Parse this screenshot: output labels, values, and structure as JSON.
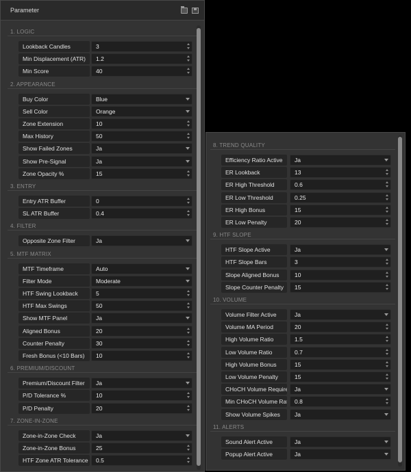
{
  "left": {
    "title": "Parameter",
    "sections": [
      {
        "label": "1. LOGIC",
        "rows": [
          {
            "label": "Lookback Candles",
            "value": "3",
            "kind": "spin"
          },
          {
            "label": "Min Displacement (ATR)",
            "value": "1.2",
            "kind": "spin"
          },
          {
            "label": "Min Score",
            "value": "40",
            "kind": "spin"
          }
        ]
      },
      {
        "label": "2. APPEARANCE",
        "rows": [
          {
            "label": "Buy Color",
            "value": "Blue",
            "kind": "select"
          },
          {
            "label": "Sell Color",
            "value": "Orange",
            "kind": "select"
          },
          {
            "label": "Zone Extension",
            "value": "10",
            "kind": "spin"
          },
          {
            "label": "Max History",
            "value": "50",
            "kind": "spin"
          },
          {
            "label": "Show Failed Zones",
            "value": "Ja",
            "kind": "select"
          },
          {
            "label": "Show Pre-Signal",
            "value": "Ja",
            "kind": "select"
          },
          {
            "label": "Zone Opacity %",
            "value": "15",
            "kind": "spin"
          }
        ]
      },
      {
        "label": "3. ENTRY",
        "rows": [
          {
            "label": "Entry ATR Buffer",
            "value": "0",
            "kind": "spin"
          },
          {
            "label": "SL ATR Buffer",
            "value": "0.4",
            "kind": "spin"
          }
        ]
      },
      {
        "label": "4. FILTER",
        "rows": [
          {
            "label": "Opposite Zone Filter",
            "value": "Ja",
            "kind": "select"
          }
        ]
      },
      {
        "label": "5. MTF MATRIX",
        "rows": [
          {
            "label": "MTF Timeframe",
            "value": "Auto",
            "kind": "select"
          },
          {
            "label": "Filter Mode",
            "value": "Moderate",
            "kind": "select"
          },
          {
            "label": "HTF Swing Lookback",
            "value": "5",
            "kind": "spin"
          },
          {
            "label": "HTF Max Swings",
            "value": "50",
            "kind": "spin"
          },
          {
            "label": "Show MTF Panel",
            "value": "Ja",
            "kind": "select"
          },
          {
            "label": "Aligned Bonus",
            "value": "20",
            "kind": "spin"
          },
          {
            "label": "Counter Penalty",
            "value": "30",
            "kind": "spin"
          },
          {
            "label": "Fresh Bonus (<10 Bars)",
            "value": "10",
            "kind": "spin"
          }
        ]
      },
      {
        "label": "6. PREMIUM/DISCOUNT",
        "rows": [
          {
            "label": "Premium/Discount Filter",
            "value": "Ja",
            "kind": "select"
          },
          {
            "label": "P/D Tolerance %",
            "value": "10",
            "kind": "spin"
          },
          {
            "label": "P/D Penalty",
            "value": "20",
            "kind": "spin"
          }
        ]
      },
      {
        "label": "7. ZONE-IN-ZONE",
        "rows": [
          {
            "label": "Zone-in-Zone Check",
            "value": "Ja",
            "kind": "select"
          },
          {
            "label": "Zone-in-Zone Bonus",
            "value": "25",
            "kind": "spin"
          },
          {
            "label": "HTF Zone ATR Tolerance",
            "value": "0.5",
            "kind": "spin"
          }
        ]
      }
    ]
  },
  "right": {
    "sections": [
      {
        "label": "8. TREND QUALITY",
        "rows": [
          {
            "label": "Efficiency Ratio Active",
            "value": "Ja",
            "kind": "select"
          },
          {
            "label": "ER Lookback",
            "value": "13",
            "kind": "spin"
          },
          {
            "label": "ER High Threshold",
            "value": "0.6",
            "kind": "spin"
          },
          {
            "label": "ER Low Threshold",
            "value": "0.25",
            "kind": "spin"
          },
          {
            "label": "ER High Bonus",
            "value": "15",
            "kind": "spin"
          },
          {
            "label": "ER Low Penalty",
            "value": "20",
            "kind": "spin"
          }
        ]
      },
      {
        "label": "9. HTF SLOPE",
        "rows": [
          {
            "label": "HTF Slope Active",
            "value": "Ja",
            "kind": "select"
          },
          {
            "label": "HTF Slope Bars",
            "value": "3",
            "kind": "spin"
          },
          {
            "label": "Slope Aligned Bonus",
            "value": "10",
            "kind": "spin"
          },
          {
            "label": "Slope Counter Penalty",
            "value": "15",
            "kind": "spin"
          }
        ]
      },
      {
        "label": "10. VOLUME",
        "rows": [
          {
            "label": "Volume Filter Active",
            "value": "Ja",
            "kind": "select"
          },
          {
            "label": "Volume MA Period",
            "value": "20",
            "kind": "spin"
          },
          {
            "label": "High Volume Ratio",
            "value": "1.5",
            "kind": "spin"
          },
          {
            "label": "Low Volume Ratio",
            "value": "0.7",
            "kind": "spin"
          },
          {
            "label": "High Volume Bonus",
            "value": "15",
            "kind": "spin"
          },
          {
            "label": "Low Volume Penalty",
            "value": "15",
            "kind": "spin"
          },
          {
            "label": "CHoCH Volume Required",
            "value": "Ja",
            "kind": "select"
          },
          {
            "label": "Min CHoCH Volume Ratio",
            "value": "0.8",
            "kind": "spin"
          },
          {
            "label": "Show Volume Spikes",
            "value": "Ja",
            "kind": "select"
          }
        ]
      },
      {
        "label": "11. ALERTS",
        "rows": [
          {
            "label": "Sound Alert Active",
            "value": "Ja",
            "kind": "select"
          },
          {
            "label": "Popup Alert Active",
            "value": "Ja",
            "kind": "select"
          }
        ]
      }
    ]
  }
}
